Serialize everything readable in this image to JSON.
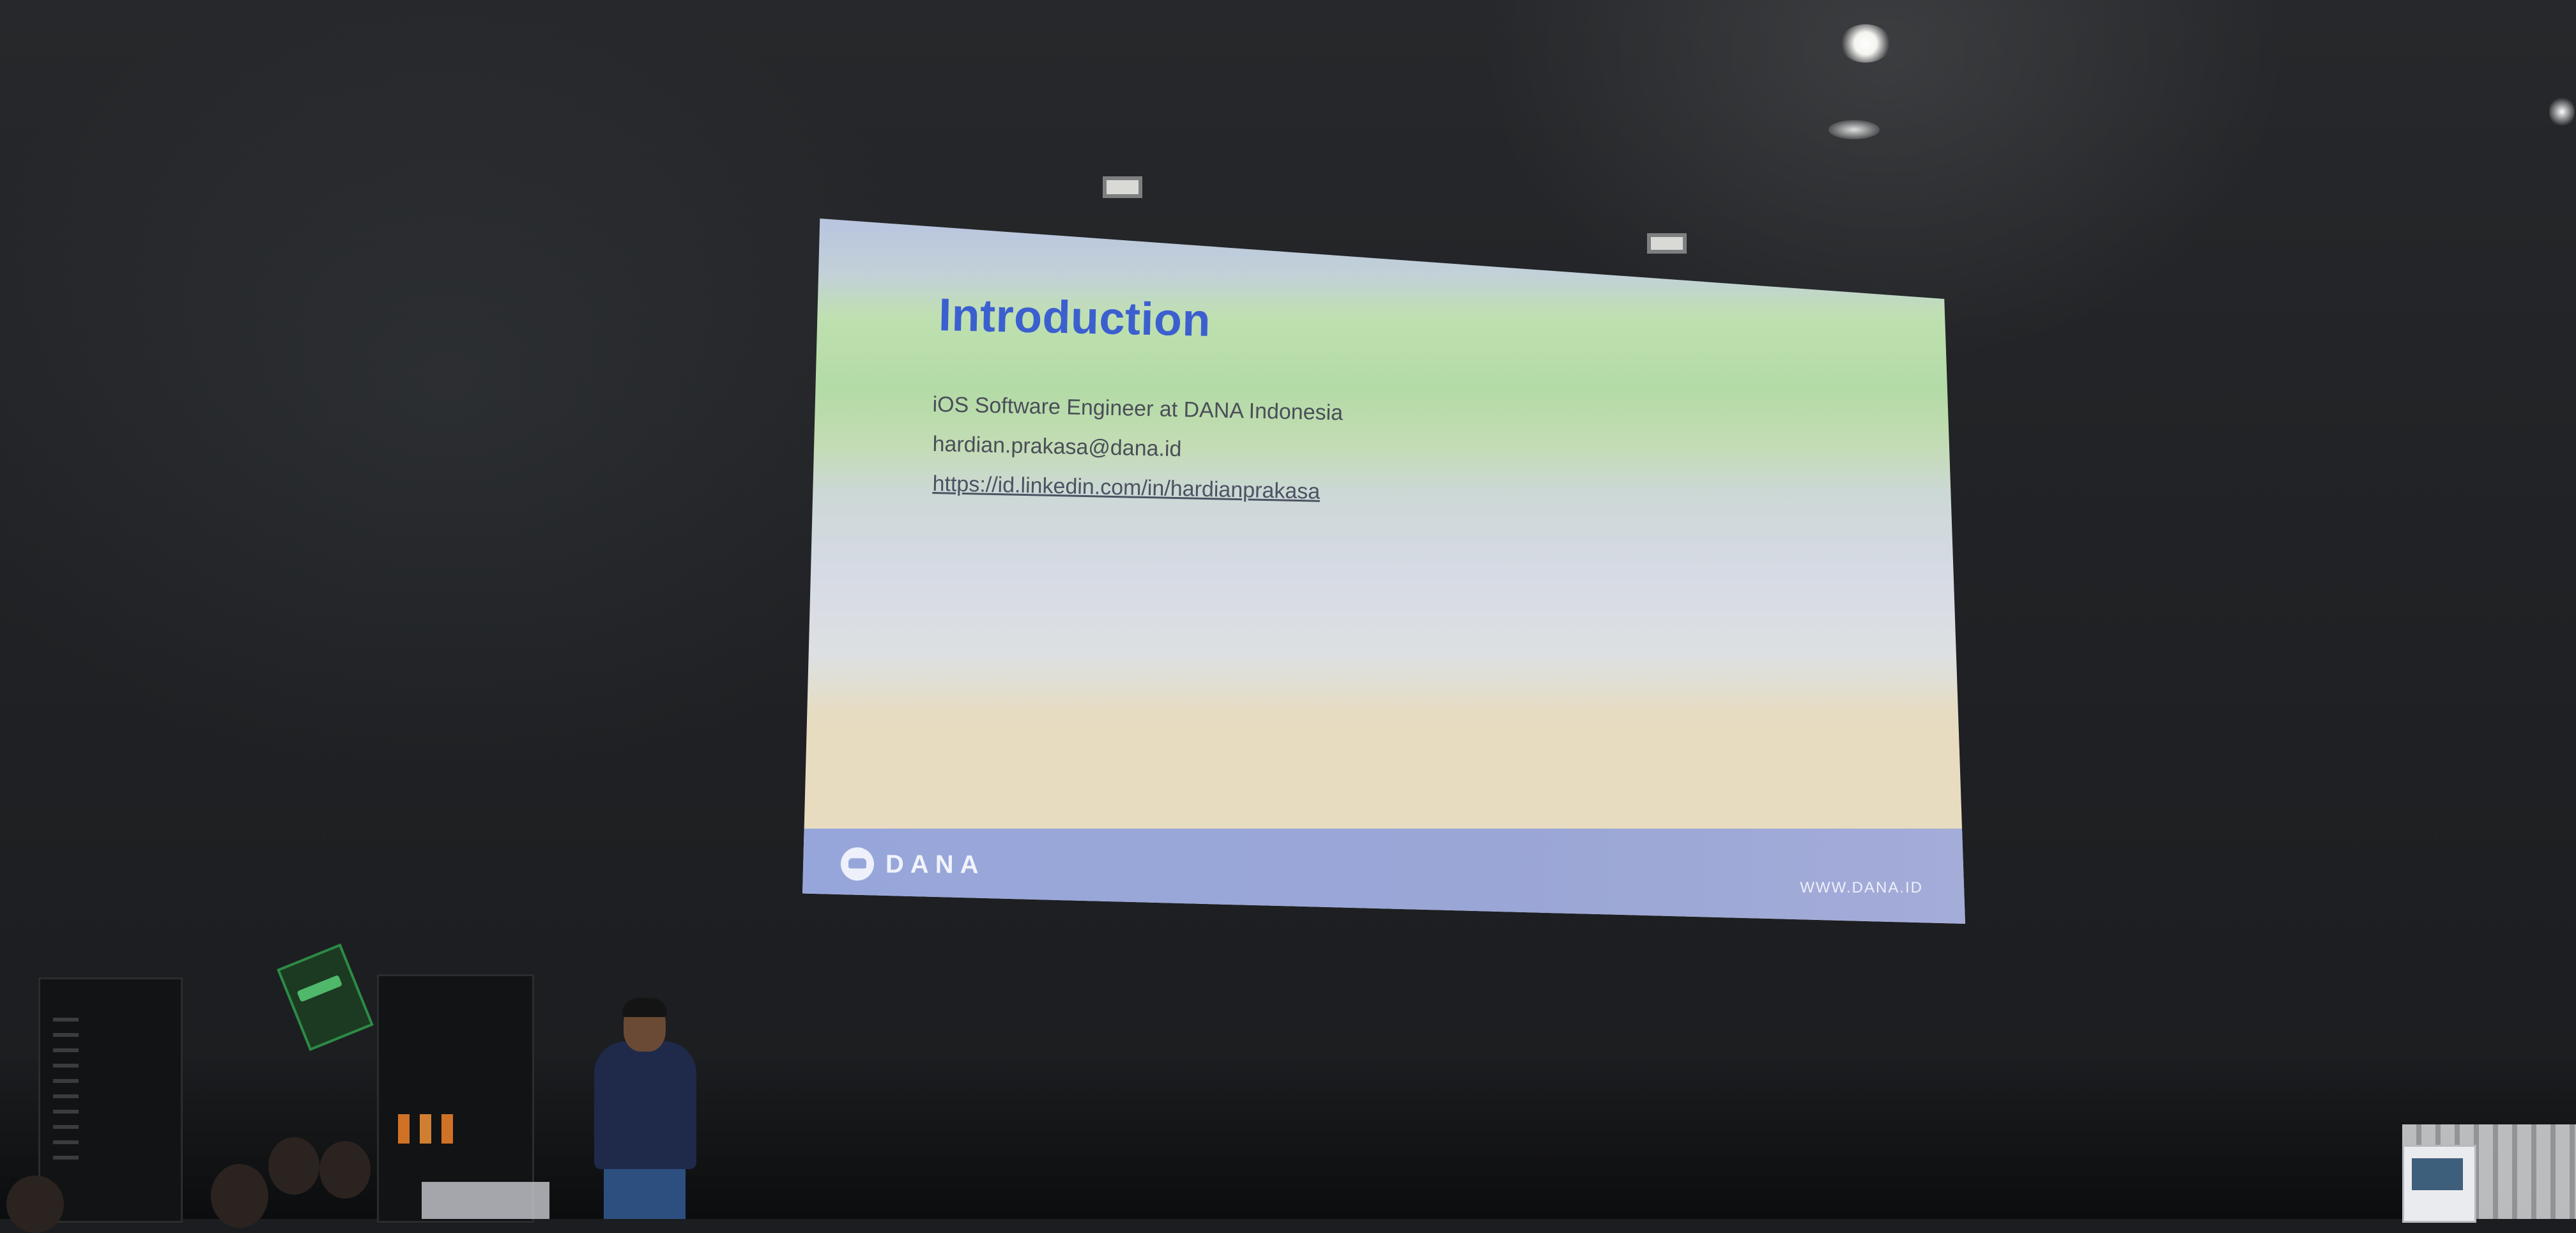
{
  "slide": {
    "title": "Introduction",
    "lines": [
      "iOS Software Engineer at DANA Indonesia",
      "hardian.prakasa@dana.id",
      "https://id.linkedin.com/in/hardianprakasa"
    ],
    "logo_text": "DANA",
    "website": "WWW.DANA.ID"
  },
  "colors": {
    "title": "#3c5fd0",
    "footer_bar": "#97a6da",
    "room": "#1b1d20"
  }
}
